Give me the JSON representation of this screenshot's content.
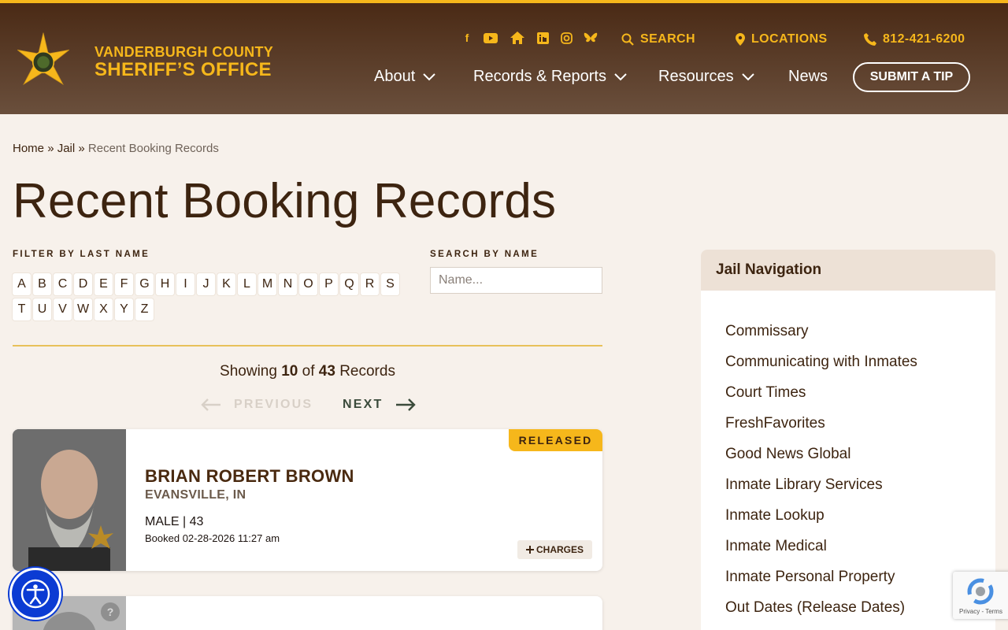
{
  "header": {
    "logo_line1": "VANDERBURGH COUNTY",
    "logo_line2": "SHERIFF’S OFFICE",
    "search_label": "SEARCH",
    "locations_label": "LOCATIONS",
    "phone": "812-421-6200",
    "submit_tip": "SUBMIT A TIP",
    "nav": [
      {
        "label": "About"
      },
      {
        "label": "Records & Reports"
      },
      {
        "label": "Resources"
      },
      {
        "label": "News"
      }
    ],
    "social_icons": [
      "facebook-icon",
      "youtube-icon",
      "home-icon",
      "linkedin-icon",
      "instagram-icon",
      "bluesky-icon"
    ]
  },
  "breadcrumb": {
    "home": "Home",
    "sep": "»",
    "jail": "Jail",
    "current": "Recent Booking Records"
  },
  "page_title": "Recent Booking Records",
  "filter": {
    "label": "FILTER BY LAST NAME",
    "letters_row1": [
      "A",
      "B",
      "C",
      "D",
      "E",
      "F",
      "G",
      "H",
      "I",
      "J",
      "K",
      "L",
      "M",
      "N",
      "O",
      "P",
      "Q",
      "R",
      "S"
    ],
    "letters_row2": [
      "T",
      "U",
      "V",
      "W",
      "X",
      "Y",
      "Z"
    ]
  },
  "search": {
    "label": "SEARCH BY NAME",
    "placeholder": "Name..."
  },
  "results": {
    "showing_prefix": "Showing",
    "shown": "10",
    "of": "of",
    "total": "43",
    "suffix": "Records",
    "prev": "PREVIOUS",
    "next": "NEXT"
  },
  "records": [
    {
      "status": "RELEASED",
      "name": "BRIAN ROBERT BROWN",
      "city": "EVANSVILLE, IN",
      "demographics": "MALE | 43",
      "booked": "Booked 02-28-2026 11:27 am",
      "charges_label": "CHARGES"
    }
  ],
  "sidebar": {
    "title": "Jail Navigation",
    "links": [
      "Commissary",
      "Communicating with Inmates",
      "Court Times",
      "FreshFavorites",
      "Good News Global",
      "Inmate Library Services",
      "Inmate Lookup",
      "Inmate Medical",
      "Inmate Personal Property",
      "Out Dates (Release Dates)"
    ]
  },
  "recaptcha_text": "Privacy - Terms",
  "colors": {
    "accent": "#f6b71b",
    "header_top": "#4a2a15",
    "text": "#3d2410",
    "a11y_blue": "#0b3bd3"
  }
}
